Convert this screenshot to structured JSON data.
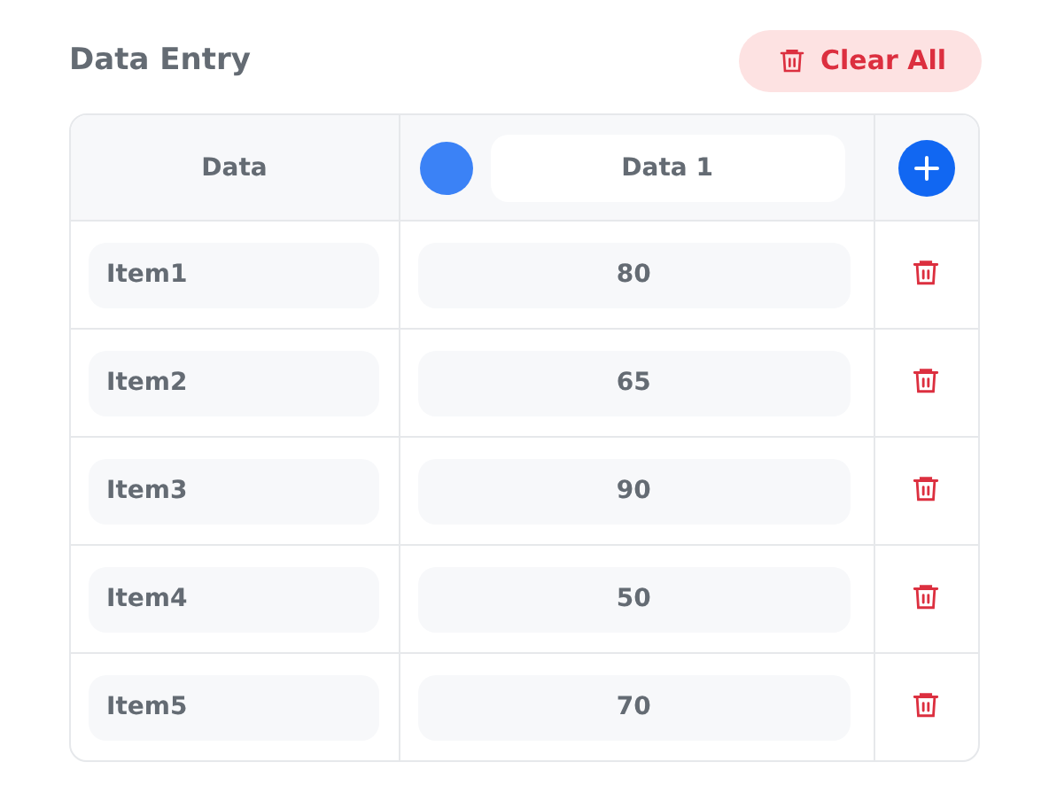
{
  "title": "Data Entry",
  "clear_button": "Clear All",
  "table": {
    "label_header": "Data",
    "series": [
      {
        "name": "Data 1",
        "color": "#3b82f6"
      }
    ],
    "rows": [
      {
        "label": "Item1",
        "value": "80"
      },
      {
        "label": "Item2",
        "value": "65"
      },
      {
        "label": "Item3",
        "value": "90"
      },
      {
        "label": "Item4",
        "value": "50"
      },
      {
        "label": "Item5",
        "value": "70"
      }
    ]
  }
}
